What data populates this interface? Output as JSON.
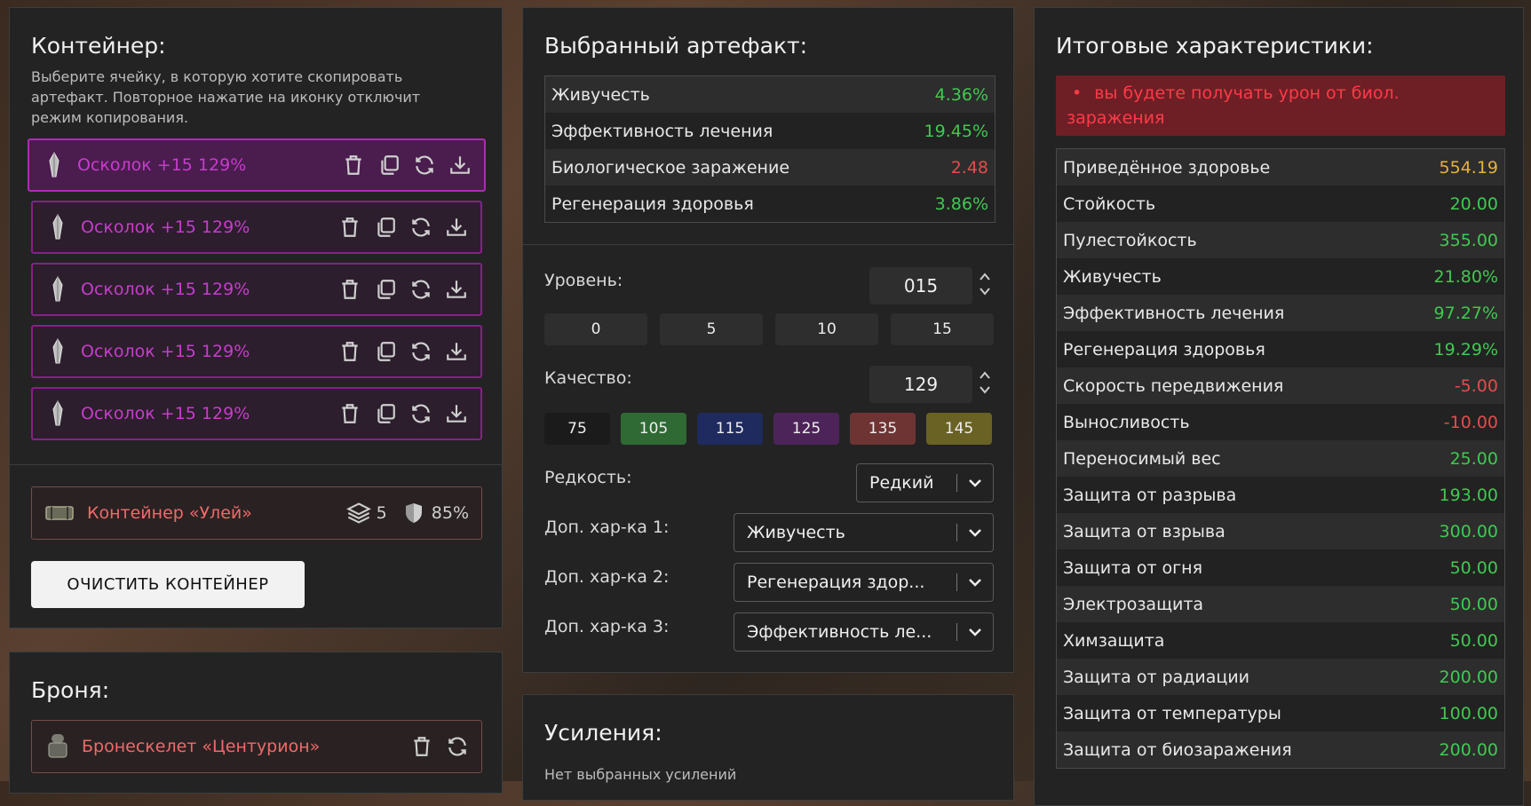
{
  "container": {
    "title": "Контейнер:",
    "hint": "Выберите ячейку, в которую хотите скопировать артефакт. Повторное нажатие на иконку отключит режим копирования.",
    "slots": [
      {
        "label": "Осколок +15 129%"
      },
      {
        "label": "Осколок +15 129%"
      },
      {
        "label": "Осколок +15 129%"
      },
      {
        "label": "Осколок +15 129%"
      },
      {
        "label": "Осколок +15 129%"
      }
    ],
    "item": {
      "name": "Контейнер «Улей»",
      "capacity": "5",
      "protection": "85%"
    },
    "clear_button": "ОЧИСТИТЬ КОНТЕЙНЕР"
  },
  "armor": {
    "title": "Броня:",
    "item": "Бронескелет «Центурион»"
  },
  "selected": {
    "title": "Выбранный артефакт:",
    "stats": [
      {
        "name": "Живучесть",
        "value": "4.36%",
        "tone": "pos"
      },
      {
        "name": "Эффективность лечения",
        "value": "19.45%",
        "tone": "pos"
      },
      {
        "name": "Биологическое заражение",
        "value": "2.48",
        "tone": "neg"
      },
      {
        "name": "Регенерация здоровья",
        "value": "3.86%",
        "tone": "pos"
      }
    ],
    "level_label": "Уровень:",
    "level_value": "015",
    "level_presets": [
      "0",
      "5",
      "10",
      "15"
    ],
    "quality_label": "Качество:",
    "quality_value": "129",
    "quality_presets": [
      {
        "label": "75",
        "color": "#1b1b1b"
      },
      {
        "label": "105",
        "color": "#2f6a35"
      },
      {
        "label": "115",
        "color": "#1f2a5e"
      },
      {
        "label": "125",
        "color": "#4d2459"
      },
      {
        "label": "135",
        "color": "#6e3434"
      },
      {
        "label": "145",
        "color": "#6a6224"
      }
    ],
    "rarity_label": "Редкость:",
    "rarity_value": "Редкий",
    "extra1_label": "Доп. хар-ка 1:",
    "extra1_value": "Живучесть",
    "extra2_label": "Доп. хар-ка 2:",
    "extra2_value": "Регенерация здор...",
    "extra3_label": "Доп. хар-ка 3:",
    "extra3_value": "Эффективность ле..."
  },
  "boosts": {
    "title": "Усиления:",
    "empty": "Нет выбранных усилений"
  },
  "totals": {
    "title": "Итоговые характеристики:",
    "warning": "вы будете получать урон от биол. заражения",
    "stats": [
      {
        "name": "Приведённое здоровье",
        "value": "554.19",
        "tone": "gold"
      },
      {
        "name": "Стойкость",
        "value": "20.00",
        "tone": "pos"
      },
      {
        "name": "Пулестойкость",
        "value": "355.00",
        "tone": "pos"
      },
      {
        "name": "Живучесть",
        "value": "21.80%",
        "tone": "pos"
      },
      {
        "name": "Эффективность лечения",
        "value": "97.27%",
        "tone": "pos"
      },
      {
        "name": "Регенерация здоровья",
        "value": "19.29%",
        "tone": "pos"
      },
      {
        "name": "Скорость передвижения",
        "value": "-5.00",
        "tone": "neg"
      },
      {
        "name": "Выносливость",
        "value": "-10.00",
        "tone": "neg"
      },
      {
        "name": "Переносимый вес",
        "value": "25.00",
        "tone": "pos"
      },
      {
        "name": "Защита от разрыва",
        "value": "193.00",
        "tone": "pos"
      },
      {
        "name": "Защита от взрыва",
        "value": "300.00",
        "tone": "pos"
      },
      {
        "name": "Защита от огня",
        "value": "50.00",
        "tone": "pos"
      },
      {
        "name": "Электрозащита",
        "value": "50.00",
        "tone": "pos"
      },
      {
        "name": "Химзащита",
        "value": "50.00",
        "tone": "pos"
      },
      {
        "name": "Защита от радиации",
        "value": "200.00",
        "tone": "pos"
      },
      {
        "name": "Защита от температуры",
        "value": "100.00",
        "tone": "pos"
      },
      {
        "name": "Защита от биозаражения",
        "value": "200.00",
        "tone": "pos"
      }
    ]
  }
}
